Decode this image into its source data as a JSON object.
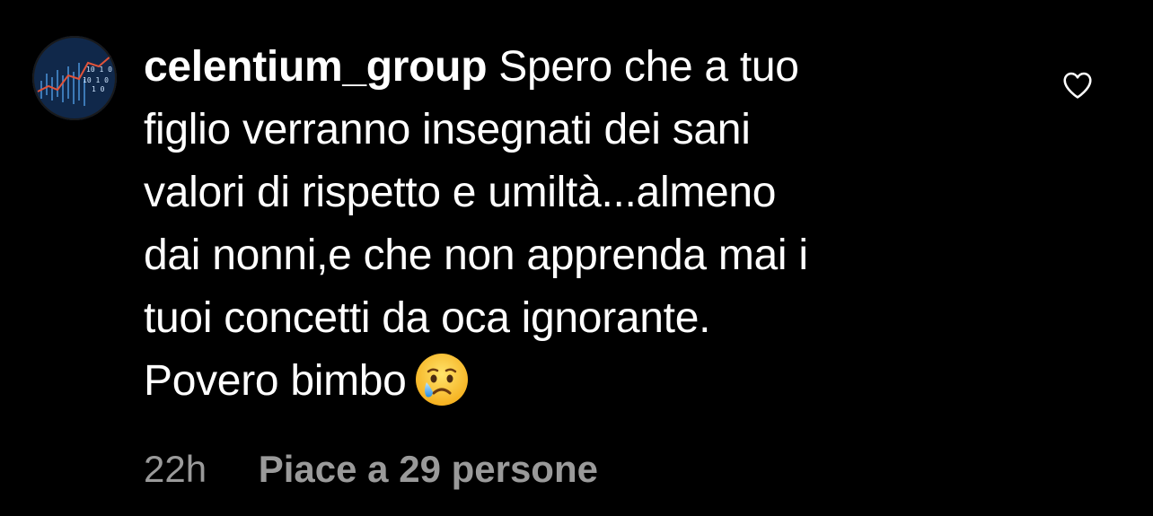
{
  "comment": {
    "username": "celentium_group",
    "text_lines": [
      "Spero che a tuo",
      "figlio verranno insegnati dei sani",
      "valori di rispetto e umiltà...almeno",
      "dai nonni,e che non apprenda mai i",
      "tuoi concetti da oca ignorante.",
      "Povero bimbo"
    ],
    "emoji": "crying-face-emoji",
    "timestamp": "22h",
    "likes_label": "Piace a 29 persone"
  },
  "icons": {
    "like": "heart-outline-icon",
    "avatar": "profile-avatar"
  },
  "colors": {
    "background": "#000000",
    "text": "#ffffff",
    "meta": "#9a9a9a"
  }
}
